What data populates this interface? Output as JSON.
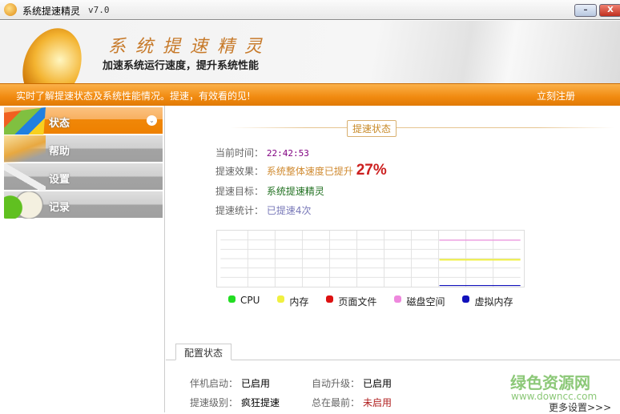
{
  "window": {
    "title": "系统提速精灵",
    "version": "v7.0",
    "minimize": "–",
    "close": "X"
  },
  "banner": {
    "brand": "系统提速精灵",
    "slogan": "加速系统运行速度，提升系统性能"
  },
  "strip": {
    "message": "实时了解提速状态及系统性能情况。提速，有效看的见!",
    "register": "立刻注册"
  },
  "sidebar": {
    "items": [
      {
        "label": "状态",
        "active": true
      },
      {
        "label": "帮助"
      },
      {
        "label": "设置"
      },
      {
        "label": "记录"
      }
    ]
  },
  "status": {
    "section_title": "提速状态",
    "rows": [
      {
        "key": "当前时间：",
        "value": "22:42:53"
      },
      {
        "key": "提速效果：",
        "value": "系统整体速度已提升",
        "percent": "27%"
      },
      {
        "key": "提速目标：",
        "value": "系统提速精灵"
      },
      {
        "key": "提速统计：",
        "value": "已提速4次"
      }
    ]
  },
  "chart_data": {
    "type": "line",
    "ylim": [
      0,
      100
    ],
    "x_start_fraction": 0.73,
    "series": [
      {
        "name": "CPU",
        "color": "#22dd22",
        "value": null
      },
      {
        "name": "内存",
        "color": "#f0f040",
        "value": 48
      },
      {
        "name": "页面文件",
        "color": "#dd1111",
        "value": null
      },
      {
        "name": "磁盘空间",
        "color": "#ee88dd",
        "value": 83
      },
      {
        "name": "虚拟内存",
        "color": "#1111bb",
        "value": 2
      }
    ]
  },
  "config": {
    "tab": "配置状态",
    "items": [
      {
        "key": "伴机启动：",
        "value": "已启用"
      },
      {
        "key": "自动升级：",
        "value": "已启用"
      },
      {
        "key": "提速级别：",
        "value": "疯狂提速"
      },
      {
        "key": "总在最前：",
        "value": "未启用"
      }
    ],
    "more": "更多设置>>>"
  },
  "watermark": {
    "name": "绿色资源网",
    "url": "www.downcc.com"
  }
}
